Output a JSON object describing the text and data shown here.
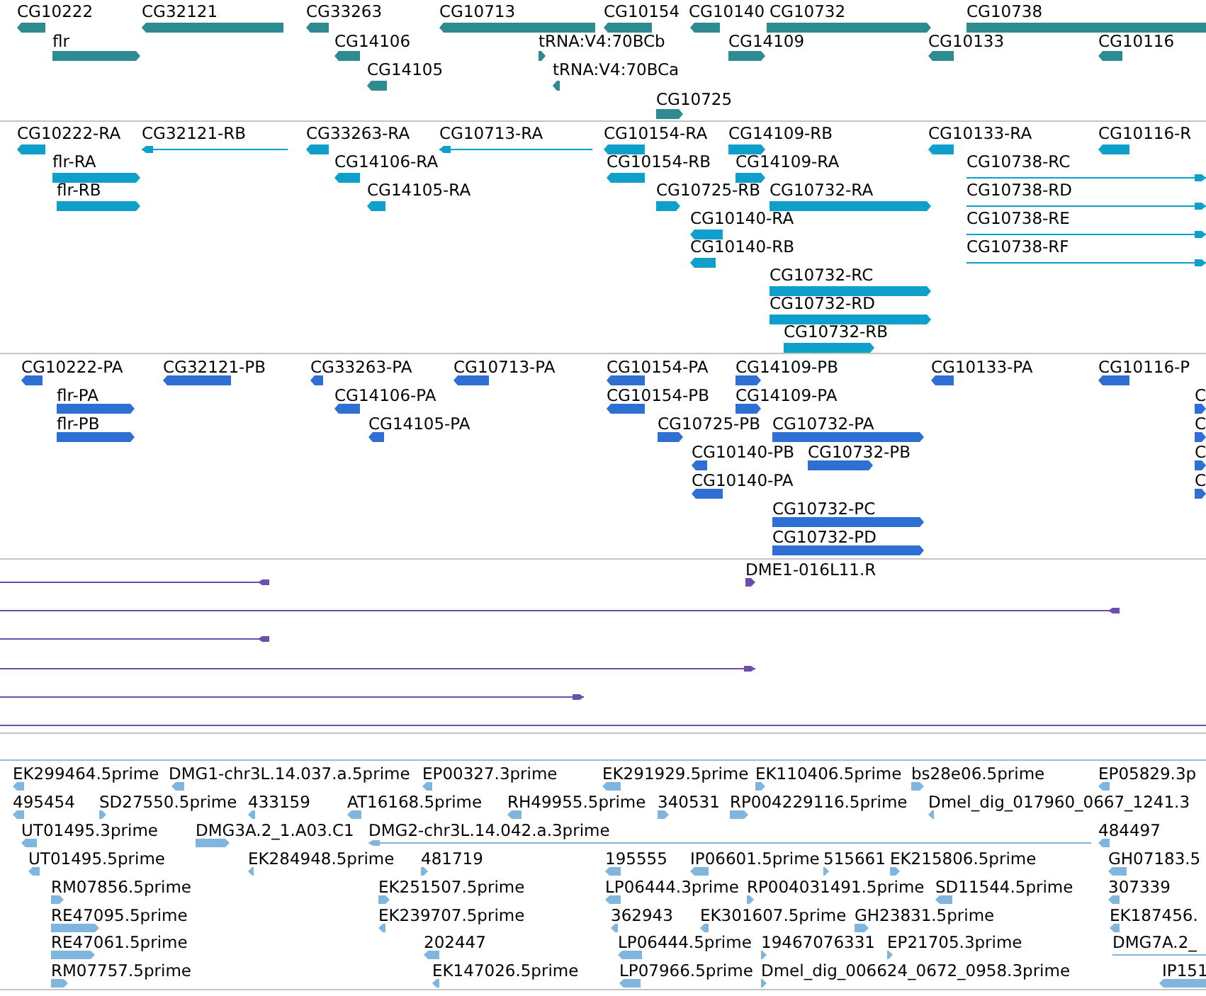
{
  "tracks": [
    {
      "features": [
        {
          "label": "CG10222",
          "reverse": true
        },
        {
          "label": "CG32121",
          "reverse": true
        },
        {
          "label": "CG33263",
          "reverse": true
        },
        {
          "label": "CG10713",
          "reverse": true
        },
        {
          "label": "CG10154",
          "reverse": true
        },
        {
          "label": "CG10140",
          "reverse": true
        },
        {
          "label": "CG10732",
          "reverse": false
        },
        {
          "label": "CG10738"
        },
        {
          "label": "flr",
          "reverse": false
        },
        {
          "label": "CG14106",
          "reverse": true
        },
        {
          "label": "tRNA:V4:70BCb",
          "reverse": false
        },
        {
          "label": "CG14109",
          "reverse": false
        },
        {
          "label": "CG10133",
          "reverse": true
        },
        {
          "label": "CG10116",
          "reverse": true
        },
        {
          "label": "CG14105",
          "reverse": true
        },
        {
          "label": "tRNA:V4:70BCa",
          "reverse": true
        },
        {
          "label": "CG10725",
          "reverse": false
        }
      ]
    },
    {
      "features": [
        {
          "label": "CG10222-RA",
          "reverse": true
        },
        {
          "label": "CG32121-RB",
          "reverse": true
        },
        {
          "label": "CG33263-RA",
          "reverse": true
        },
        {
          "label": "CG10713-RA",
          "reverse": true
        },
        {
          "label": "CG10154-RA",
          "reverse": true
        },
        {
          "label": "CG14109-RB",
          "reverse": false
        },
        {
          "label": "CG10133-RA",
          "reverse": true
        },
        {
          "label": "CG10116-R",
          "reverse": true
        },
        {
          "label": "flr-RA",
          "reverse": false
        },
        {
          "label": "CG14106-RA",
          "reverse": true
        },
        {
          "label": "CG10154-RB",
          "reverse": true
        },
        {
          "label": "CG14109-RA",
          "reverse": false
        },
        {
          "label": "CG10738-RC",
          "reverse": false
        },
        {
          "label": "flr-RB",
          "reverse": false
        },
        {
          "label": "CG14105-RA",
          "reverse": true
        },
        {
          "label": "CG10725-RB",
          "reverse": false
        },
        {
          "label": "CG10732-RA",
          "reverse": false
        },
        {
          "label": "CG10738-RD",
          "reverse": false
        },
        {
          "label": "CG10140-RA",
          "reverse": true
        },
        {
          "label": "CG10738-RE",
          "reverse": false
        },
        {
          "label": "CG10140-RB",
          "reverse": true
        },
        {
          "label": "CG10738-RF",
          "reverse": false
        },
        {
          "label": "CG10732-RC",
          "reverse": false
        },
        {
          "label": "CG10732-RD",
          "reverse": false
        },
        {
          "label": "CG10732-RB",
          "reverse": false
        }
      ]
    },
    {
      "features": [
        {
          "label": "CG10222-PA",
          "reverse": true
        },
        {
          "label": "CG32121-PB",
          "reverse": true
        },
        {
          "label": "CG33263-PA",
          "reverse": true
        },
        {
          "label": "CG10713-PA",
          "reverse": true
        },
        {
          "label": "CG10154-PA",
          "reverse": true
        },
        {
          "label": "CG14109-PB",
          "reverse": false
        },
        {
          "label": "CG10133-PA",
          "reverse": true
        },
        {
          "label": "CG10116-P",
          "reverse": true
        },
        {
          "label": "flr-PA",
          "reverse": false
        },
        {
          "label": "CG14106-PA",
          "reverse": true
        },
        {
          "label": "CG10154-PB",
          "reverse": true
        },
        {
          "label": "CG14109-PA",
          "reverse": false
        },
        {
          "label": "C",
          "reverse": false
        },
        {
          "label": "flr-PB",
          "reverse": false
        },
        {
          "label": "CG14105-PA",
          "reverse": true
        },
        {
          "label": "CG10725-PB",
          "reverse": false
        },
        {
          "label": "CG10732-PA",
          "reverse": false
        },
        {
          "label": "C",
          "reverse": false
        },
        {
          "label": "CG10140-PB",
          "reverse": true
        },
        {
          "label": "CG10732-PB",
          "reverse": false
        },
        {
          "label": "C",
          "reverse": false
        },
        {
          "label": "CG10140-PA",
          "reverse": true
        },
        {
          "label": "C",
          "reverse": false
        },
        {
          "label": "CG10732-PC",
          "reverse": false
        },
        {
          "label": "CG10732-PD",
          "reverse": false
        }
      ]
    },
    {
      "features": [
        {
          "kind": "line",
          "reverse": true
        },
        {
          "kind": "arrow",
          "label": "DME1-016L11.R",
          "reverse": false
        },
        {
          "kind": "line",
          "reverse": true
        },
        {
          "kind": "line",
          "reverse": true
        },
        {
          "kind": "line",
          "reverse": false
        },
        {
          "kind": "line",
          "reverse": false
        },
        {
          "kind": "line"
        }
      ]
    },
    {
      "features": [
        {
          "label": "EK299464.5prime",
          "reverse": true
        },
        {
          "label": "DMG1-chr3L.14.037.a.5prime",
          "reverse": true
        },
        {
          "label": "EP00327.3prime",
          "reverse": true
        },
        {
          "label": "EK291929.5prime",
          "reverse": true
        },
        {
          "label": "EK110406.5prime",
          "reverse": false
        },
        {
          "label": "bs28e06.5prime",
          "reverse": false
        },
        {
          "label": "EP05829.3p",
          "reverse": true
        },
        {
          "label": "495454",
          "reverse": true
        },
        {
          "label": "SD27550.5prime",
          "reverse": false
        },
        {
          "label": "433159",
          "reverse": true
        },
        {
          "label": "AT16168.5prime",
          "reverse": true
        },
        {
          "label": "RH49955.5prime",
          "reverse": true
        },
        {
          "label": "340531",
          "reverse": false
        },
        {
          "label": "RP004229116.5prime",
          "reverse": false
        },
        {
          "label": "Dmel_dig_017960_0667_1241.3",
          "reverse": true
        },
        {
          "label": "UT01495.3prime",
          "reverse": true
        },
        {
          "label": "DMG3A.2_1.A03.C1",
          "reverse": false
        },
        {
          "label": "DMG2-chr3L.14.042.a.3prime",
          "reverse": true
        },
        {
          "label": "484497",
          "reverse": true
        },
        {
          "label": "UT01495.5prime",
          "reverse": true
        },
        {
          "label": "EK284948.5prime",
          "reverse": true
        },
        {
          "label": "481719",
          "reverse": false
        },
        {
          "label": "195555",
          "reverse": true
        },
        {
          "label": "IP06601.5prime",
          "reverse": true
        },
        {
          "label": "515661",
          "reverse": false
        },
        {
          "label": "EK215806.5prime",
          "reverse": false
        },
        {
          "label": "GH07183.5",
          "reverse": true
        },
        {
          "label": "RM07856.5prime",
          "reverse": false
        },
        {
          "label": "EK251507.5prime",
          "reverse": false
        },
        {
          "label": "LP06444.3prime",
          "reverse": true
        },
        {
          "label": "RP004031491.5prime",
          "reverse": false
        },
        {
          "label": "SD11544.5prime",
          "reverse": true
        },
        {
          "label": "307339",
          "reverse": true
        },
        {
          "label": "RE47095.5prime",
          "reverse": false
        },
        {
          "label": "EK239707.5prime",
          "reverse": true
        },
        {
          "label": "362943",
          "reverse": true
        },
        {
          "label": "EK301607.5prime",
          "reverse": true
        },
        {
          "label": "GH23831.5prime",
          "reverse": false
        },
        {
          "label": "EK187456.",
          "reverse": true
        },
        {
          "label": "RE47061.5prime",
          "reverse": false
        },
        {
          "label": "202447",
          "reverse": true
        },
        {
          "label": "LP06444.5prime",
          "reverse": true
        },
        {
          "label": "19467076331",
          "reverse": false
        },
        {
          "label": "EP21705.3prime",
          "reverse": false
        },
        {
          "label": "DMG7A.2_"
        },
        {
          "label": "RM07757.5prime",
          "reverse": false
        },
        {
          "label": "EK147026.5prime",
          "reverse": true
        },
        {
          "label": "LP07966.5prime",
          "reverse": true
        },
        {
          "label": "Dmel_dig_006624_0672_0958.3prime",
          "reverse": false
        },
        {
          "label": "IP151",
          "reverse": true
        }
      ]
    }
  ]
}
